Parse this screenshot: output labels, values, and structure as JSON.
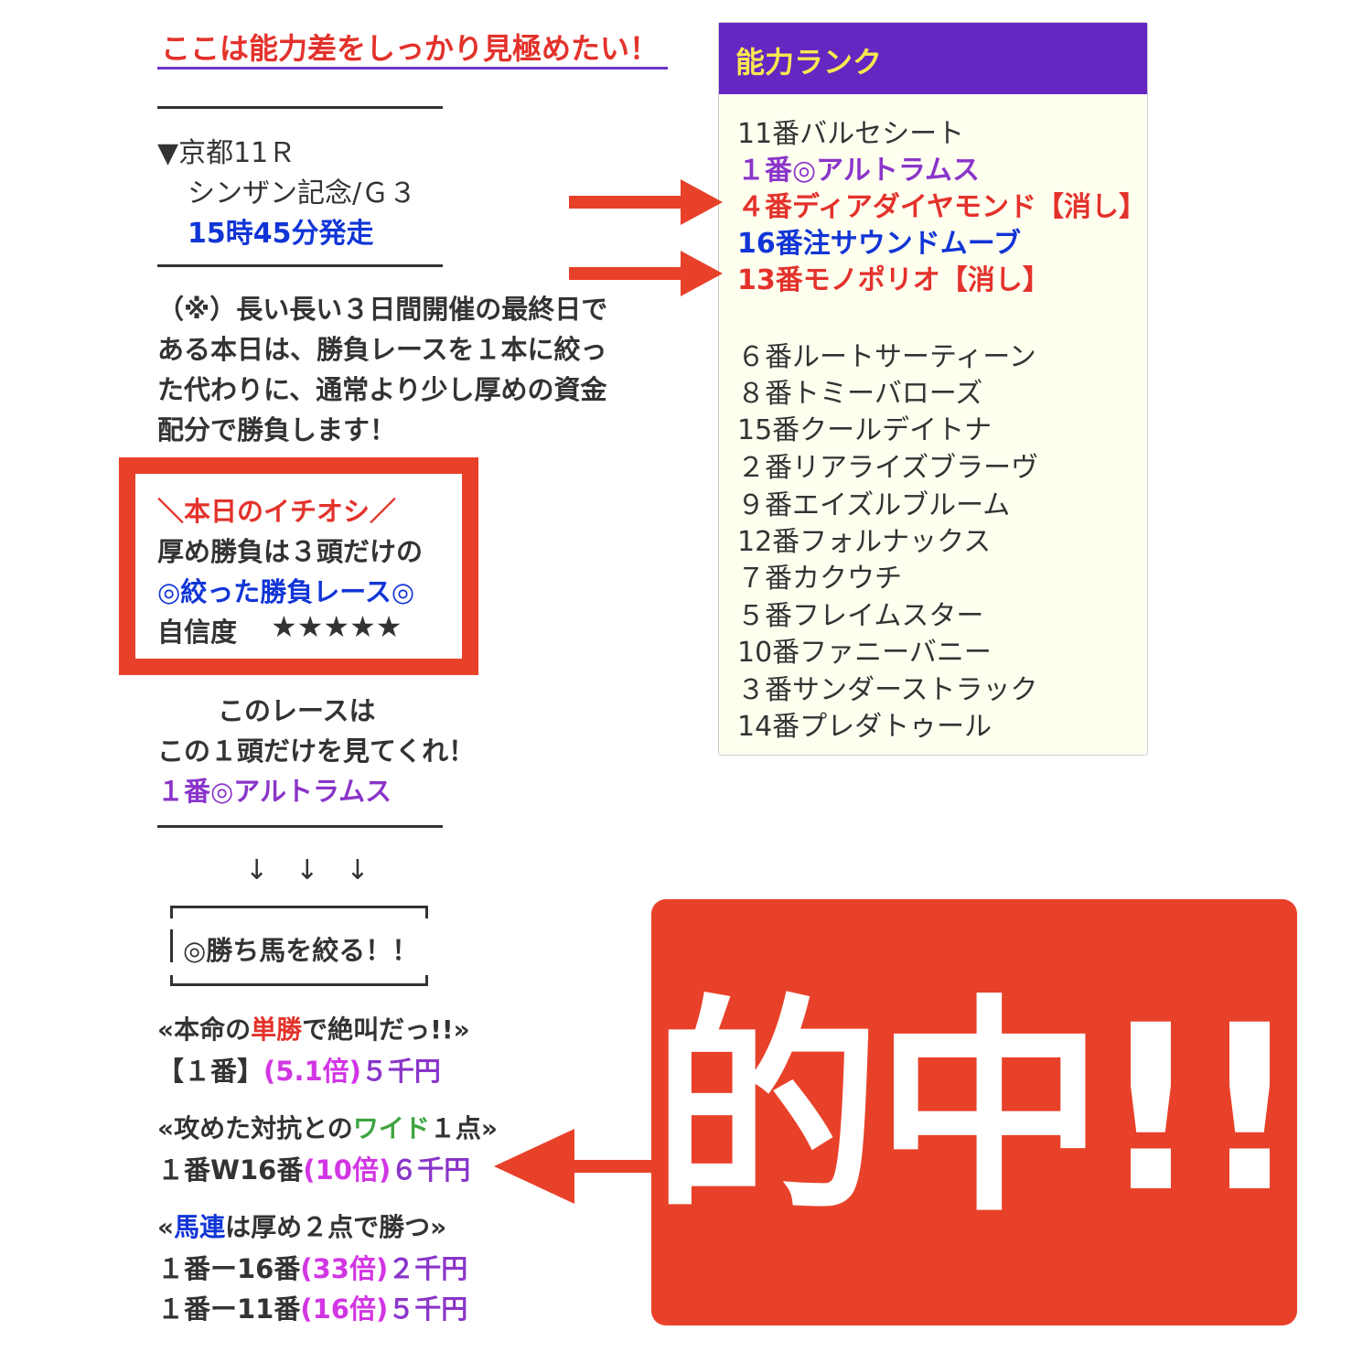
{
  "heading": "ここは能力差をしっかり見極めたい！",
  "race": {
    "line1": "▼京都11Ｒ",
    "line2": "シンザン記念/Ｇ３",
    "line3": "15時45分発走"
  },
  "paragraph": [
    "（※）長い長い３日間開催の最終日で",
    "ある本日は、勝負レースを１本に絞っ",
    "た代わりに、通常より少し厚めの資金",
    "配分で勝負します！"
  ],
  "pick_box": {
    "line1": "＼本日のイチオシ／",
    "line2": "厚め勝負は３頭だけの",
    "line3": "◎絞った勝負レース◎",
    "line4_label": "自信度",
    "line4_stars": "★★★★★"
  },
  "focus": {
    "line1": "このレースは",
    "line2": "この１頭だけを見てくれ！",
    "line3": "１番◎アルトラムス"
  },
  "down_arrows": "↓　↓　↓",
  "win_box": "◎勝ち馬を絞る！！",
  "bets": {
    "tansho_pre": "«本命の",
    "tansho_key": "単勝",
    "tansho_post": "で絶叫だっ!!»",
    "tansho_horse": "【１番】",
    "tansho_odds": "(5.1倍)",
    "tansho_amount": "５千円",
    "wide_pre": "«攻めた対抗との",
    "wide_key": "ワイド",
    "wide_post": "１点»",
    "wide_horse": "１番W16番",
    "wide_odds": "(10倍)",
    "wide_amount": "６千円",
    "umaren_pre": "«",
    "umaren_key": "馬連",
    "umaren_post": "は厚め２点で勝つ»",
    "umaren1_horse": "１番ー16番",
    "umaren1_odds": "(33倍)",
    "umaren1_amount": "２千円",
    "umaren2_horse": "１番ー11番",
    "umaren2_odds": "(16倍)",
    "umaren2_amount": "５千円"
  },
  "rank": {
    "title": "能力ランク",
    "top": [
      {
        "text": "11番バルセシート",
        "style": "plain"
      },
      {
        "text": "１番◎アルトラムス",
        "style": "purple"
      },
      {
        "text": "４番ディアダイヤモンド【消し】",
        "style": "red"
      },
      {
        "text": "16番注サウンドムーブ",
        "style": "blue"
      },
      {
        "text": "13番モノポリオ【消し】",
        "style": "red"
      }
    ],
    "rest": [
      "６番ルートサーティーン",
      "８番トミーバローズ",
      "15番クールデイトナ",
      "２番リアライズブラーヴ",
      "９番エイズルブルーム",
      "12番フォルナックス",
      "７番カクウチ",
      "５番フレイムスター",
      "10番ファニーバニー",
      "３番サンダーストラック",
      "14番プレダトゥール"
    ]
  },
  "hit": "的中!!",
  "colors": {
    "accent_red": "#e8412a",
    "rank_header": "#6526c2",
    "rank_title": "#f6e84f",
    "blue": "#1135d6",
    "purple": "#8a35c9",
    "magenta": "#d236e4",
    "green": "#3fa43f"
  }
}
